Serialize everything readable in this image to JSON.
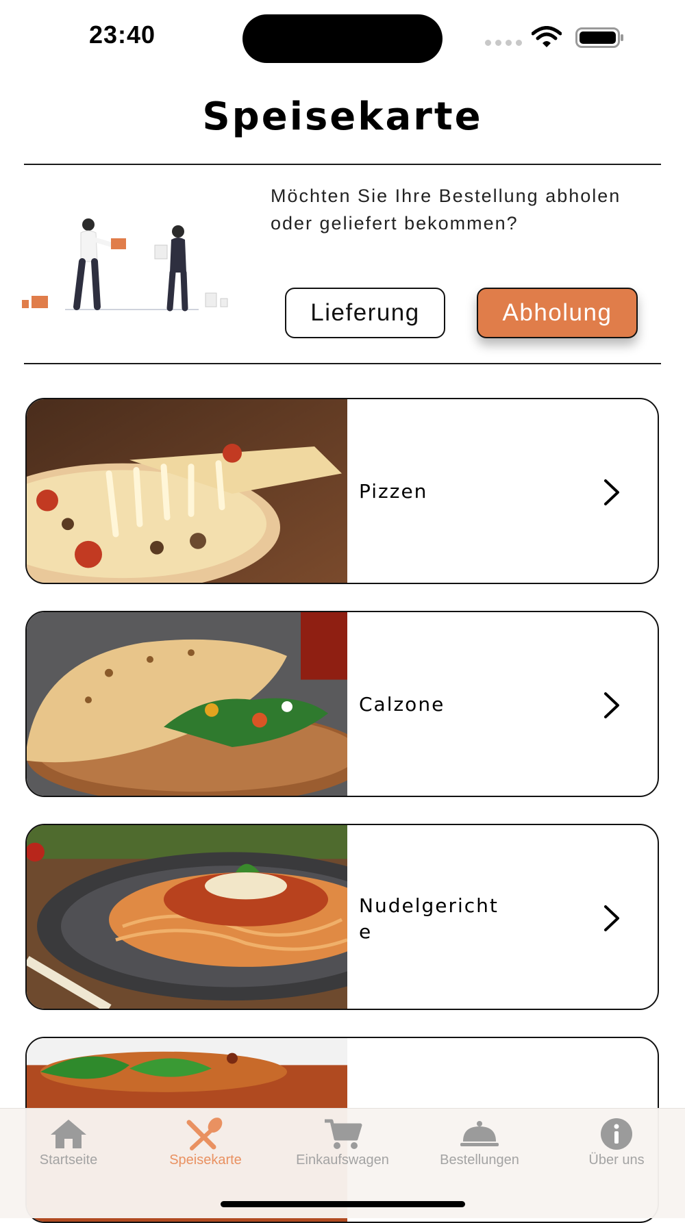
{
  "status_bar": {
    "time": "23:40"
  },
  "header": {
    "title": "Speisekarte"
  },
  "order_type": {
    "question": "Möchten Sie Ihre Bestellung abholen oder geliefert bekommen?",
    "delivery_label": "Lieferung",
    "pickup_label": "Abholung",
    "selected": "Abholung"
  },
  "categories": [
    {
      "label": "Pizzen",
      "image": "pizza-photo"
    },
    {
      "label": "Calzone",
      "image": "calzone-photo"
    },
    {
      "label": "Nudelgerichte",
      "image": "spaghetti-photo"
    },
    {
      "label": "",
      "image": "lasagne-photo"
    }
  ],
  "tab_bar": {
    "items": [
      {
        "label": "Startseite",
        "icon": "home-icon"
      },
      {
        "label": "Speisekarte",
        "icon": "fork-knife-icon",
        "active": true
      },
      {
        "label": "Einkaufswagen",
        "icon": "cart-icon"
      },
      {
        "label": "Bestellungen",
        "icon": "cloche-icon"
      },
      {
        "label": "Über uns",
        "icon": "info-icon"
      }
    ]
  },
  "colors": {
    "accent": "#e07d4a",
    "active_tab": "#e99161",
    "inactive_tab": "#a3a3a3"
  }
}
